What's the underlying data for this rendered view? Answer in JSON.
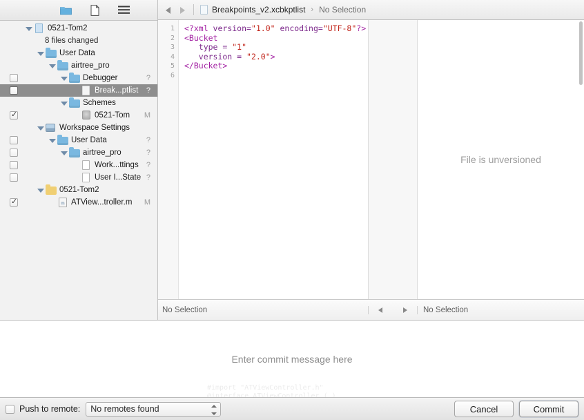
{
  "sidebar": {
    "toolbar": [
      {
        "name": "folder-icon",
        "glyph": "folder"
      },
      {
        "name": "document-icon",
        "glyph": "document"
      },
      {
        "name": "list-icon",
        "glyph": "hamburger"
      }
    ],
    "tree": [
      {
        "label": "0521-Tom2",
        "sub": "8 files changed",
        "icon": "doc-blue",
        "indent": 0,
        "twisty": "open",
        "checkbox": "none",
        "status": "",
        "selected": false
      },
      {
        "label": "User Data",
        "icon": "folder-blue",
        "indent": 1,
        "twisty": "open",
        "checkbox": "none",
        "status": "",
        "selected": false
      },
      {
        "label": "airtree_pro",
        "icon": "folder-blue",
        "indent": 2,
        "twisty": "open",
        "checkbox": "none",
        "status": "",
        "selected": false
      },
      {
        "label": "Debugger",
        "icon": "folder-blue",
        "indent": 3,
        "twisty": "open",
        "checkbox": "unchecked",
        "status": "?",
        "selected": false
      },
      {
        "label": "Break...ptlist",
        "icon": "doc",
        "indent": 4,
        "twisty": "none",
        "checkbox": "unchecked",
        "status": "?",
        "selected": true
      },
      {
        "label": "Schemes",
        "icon": "folder-blue",
        "indent": 3,
        "twisty": "open",
        "checkbox": "none",
        "status": "",
        "selected": false
      },
      {
        "label": "0521-Tom",
        "icon": "scheme",
        "indent": 4,
        "twisty": "none",
        "checkbox": "checked",
        "status": "M",
        "selected": false
      },
      {
        "label": "Workspace Settings",
        "icon": "workspace",
        "indent": 1,
        "twisty": "open",
        "checkbox": "none",
        "status": "",
        "selected": false
      },
      {
        "label": "User Data",
        "icon": "folder-blue",
        "indent": 2,
        "twisty": "open",
        "checkbox": "unchecked",
        "status": "?",
        "selected": false
      },
      {
        "label": "airtree_pro",
        "icon": "folder-blue",
        "indent": 3,
        "twisty": "open",
        "checkbox": "unchecked",
        "status": "?",
        "selected": false
      },
      {
        "label": "Work...ttings",
        "icon": "doc",
        "indent": 4,
        "twisty": "none",
        "checkbox": "unchecked",
        "status": "?",
        "selected": false
      },
      {
        "label": "User I...State",
        "icon": "doc",
        "indent": 4,
        "twisty": "none",
        "checkbox": "unchecked",
        "status": "?",
        "selected": false
      },
      {
        "label": "0521-Tom2",
        "icon": "folder-yellow",
        "indent": 1,
        "twisty": "open",
        "checkbox": "none",
        "status": "",
        "selected": false
      },
      {
        "label": "ATView...troller.m",
        "icon": "m-file",
        "indent": 2,
        "twisty": "none",
        "checkbox": "checked",
        "status": "M",
        "selected": false
      }
    ]
  },
  "editor": {
    "breadcrumb": {
      "file": "Breakpoints_v2.xcbkptlist",
      "separator": "›",
      "selection": "No Selection"
    },
    "line_numbers": [
      "1",
      "2",
      "3",
      "4",
      "5",
      "6"
    ],
    "code_lines": [
      [
        {
          "t": "<?xml ",
          "c": "tag"
        },
        {
          "t": "version=",
          "c": "attr"
        },
        {
          "t": "\"1.0\"",
          "c": "val"
        },
        {
          "t": " encoding=",
          "c": "attr"
        },
        {
          "t": "\"UTF-8\"",
          "c": "val"
        },
        {
          "t": "?>",
          "c": "tag"
        }
      ],
      [
        {
          "t": "<Bucket",
          "c": "tag"
        }
      ],
      [
        {
          "t": "   type = ",
          "c": "attr"
        },
        {
          "t": "\"1\"",
          "c": "val"
        }
      ],
      [
        {
          "t": "   version = ",
          "c": "attr"
        },
        {
          "t": "\"2.0\"",
          "c": "val"
        },
        {
          "t": ">",
          "c": "tag"
        }
      ],
      [
        {
          "t": "</Bucket>",
          "c": "tag"
        }
      ],
      [
        {
          "t": "",
          "c": "tag"
        }
      ]
    ],
    "unversioned_message": "File is unversioned",
    "status_bar": {
      "left": "No Selection",
      "right": "No Selection"
    }
  },
  "commit": {
    "message_placeholder": "Enter commit message here",
    "push_label": "Push to remote:",
    "remote_value": "No remotes found",
    "cancel_label": "Cancel",
    "commit_label": "Commit"
  },
  "ghost_lines": [
    "#import \"ATViewController.h\"",
    "@interface ATViewController ( )"
  ],
  "colors": {
    "selection": "#8e8e8e",
    "tag": "#a21fa2",
    "value": "#c2261c",
    "folder_blue": "#7ab8e0",
    "folder_yellow": "#f0cf73",
    "muted_text": "#9c9c9c"
  }
}
